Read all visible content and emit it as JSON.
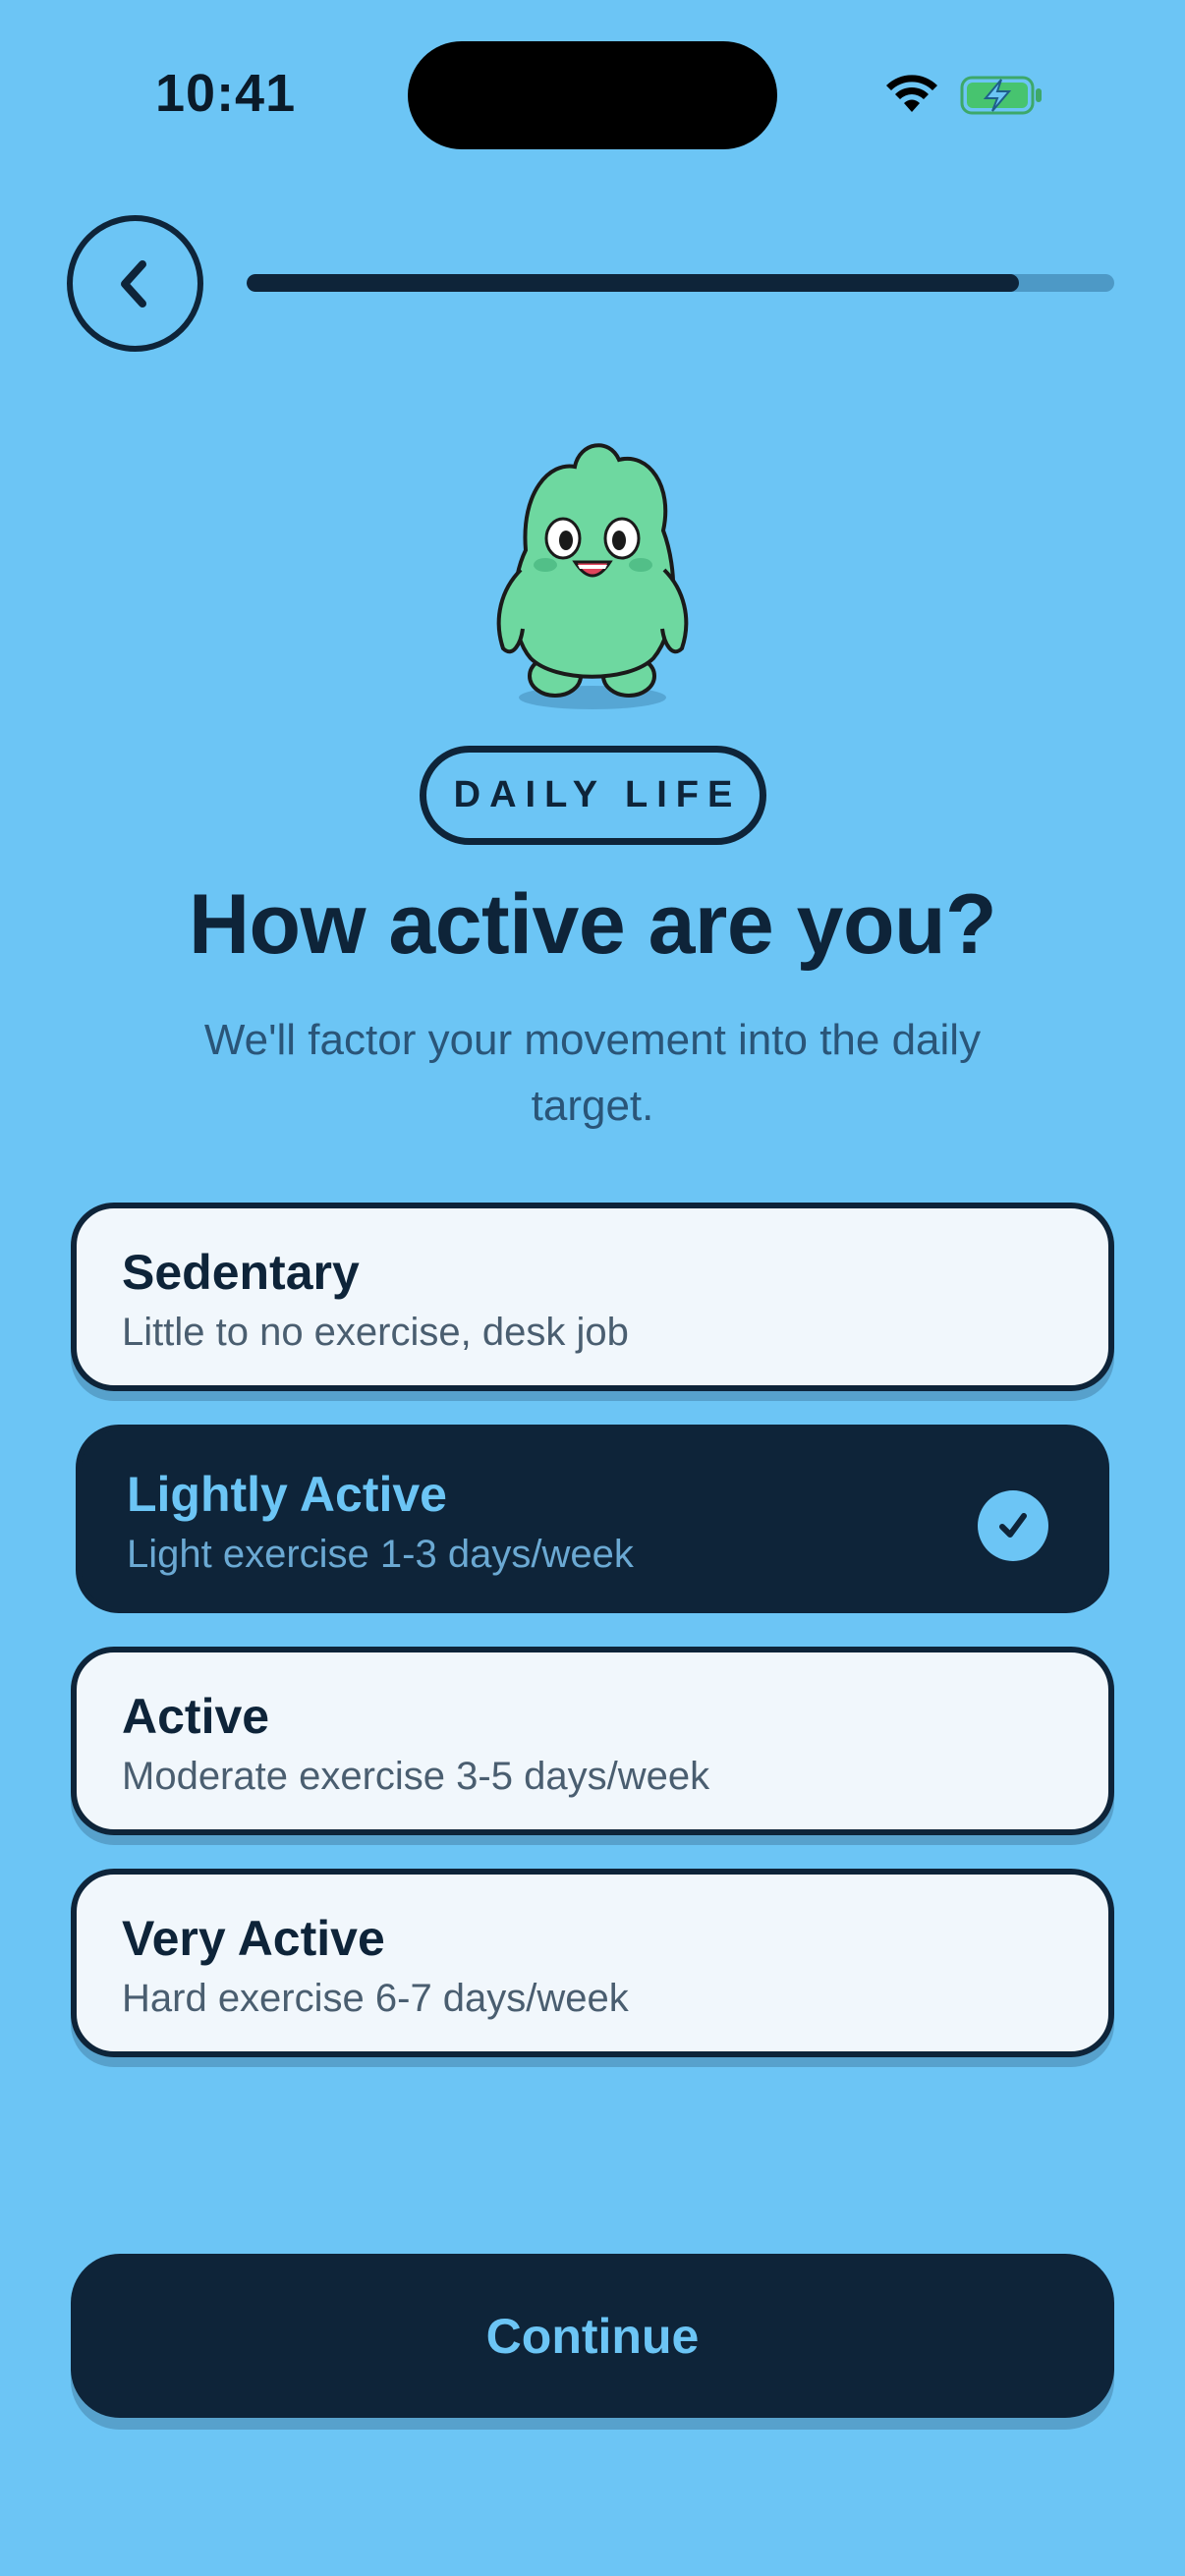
{
  "status_bar": {
    "time": "10:41",
    "wifi_icon": "wifi-icon",
    "battery_icon": "battery-charging-icon"
  },
  "header": {
    "back_icon": "chevron-left-icon",
    "progress_fraction": 0.89
  },
  "mascot": {
    "icon": "green-monster-mascot"
  },
  "category_label": "DAILY LIFE",
  "title": "How active are you?",
  "subtitle": "We'll factor your movement into the daily target.",
  "options": [
    {
      "title": "Sedentary",
      "description": "Little to no exercise, desk job",
      "selected": false
    },
    {
      "title": "Lightly Active",
      "description": "Light exercise 1-3 days/week",
      "selected": true
    },
    {
      "title": "Active",
      "description": "Moderate exercise 3-5 days/week",
      "selected": false
    },
    {
      "title": "Very Active",
      "description": "Hard exercise 6-7 days/week",
      "selected": false
    }
  ],
  "continue_label": "Continue",
  "colors": {
    "background": "#6CC5F5",
    "dark": "#0E2439",
    "card": "#F1F7FC",
    "mascot_green": "#6ED8A0"
  }
}
